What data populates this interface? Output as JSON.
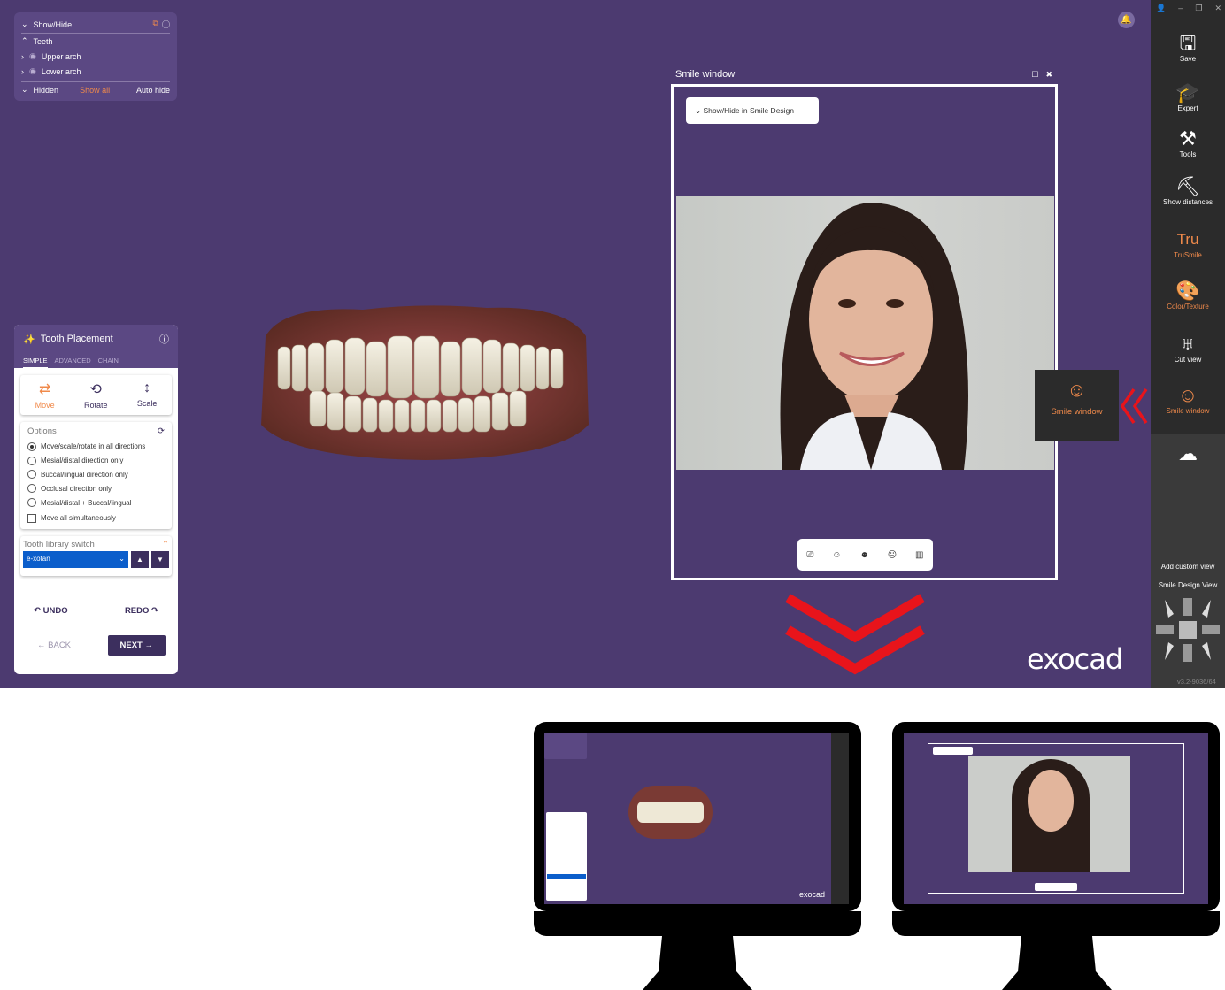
{
  "showhide": {
    "title": "Show/Hide",
    "teeth_label": "Teeth",
    "upper_label": "Upper arch",
    "lower_label": "Lower arch",
    "hidden_label": "Hidden",
    "show_all": "Show all",
    "auto_hide": "Auto hide"
  },
  "tooth_placement": {
    "title": "Tooth Placement",
    "tabs": [
      "SIMPLE",
      "ADVANCED",
      "CHAIN"
    ],
    "move": "Move",
    "rotate": "Rotate",
    "scale": "Scale",
    "options_title": "Options",
    "options": [
      "Move/scale/rotate in all directions",
      "Mesial/distal direction only",
      "Buccal/lingual direction only",
      "Occlusal direction only",
      "Mesial/distal + Buccal/lingual"
    ],
    "selected_option_index": 0,
    "checkbox_label": "Move all simultaneously",
    "library_title": "Tooth library switch",
    "library_value": "e-xofan",
    "undo": "UNDO",
    "redo": "REDO",
    "back": "BACK",
    "next": "NEXT"
  },
  "smile_window": {
    "title": "Smile window",
    "dropdown": "Show/Hide in Smile Design"
  },
  "toolbar": {
    "items": [
      {
        "label": "Save",
        "icon": "save-icon"
      },
      {
        "label": "Expert",
        "icon": "graduation-cap-icon"
      },
      {
        "label": "Tools",
        "icon": "tools-icon"
      },
      {
        "label": "Show distances",
        "icon": "show-distances-icon"
      },
      {
        "label": "TruSmile",
        "icon": "trusmile-icon",
        "glyph": "Tru"
      },
      {
        "label": "Color/Texture",
        "icon": "palette-icon"
      },
      {
        "label": "Cut view",
        "icon": "cut-view-icon"
      },
      {
        "label": "Smile window",
        "icon": "face-icon"
      }
    ],
    "add_custom_view": "Add custom view",
    "smile_design_view": "Smile Design View",
    "version": "v3.2-9036/64"
  },
  "popup": {
    "label": "Smile window"
  },
  "logo": "exocad",
  "colors": {
    "background": "#4c3a70",
    "panel": "#5b4883",
    "accent": "#f08a4b",
    "arrow": "#e8141b",
    "toolbar": "#2b2b2b"
  }
}
